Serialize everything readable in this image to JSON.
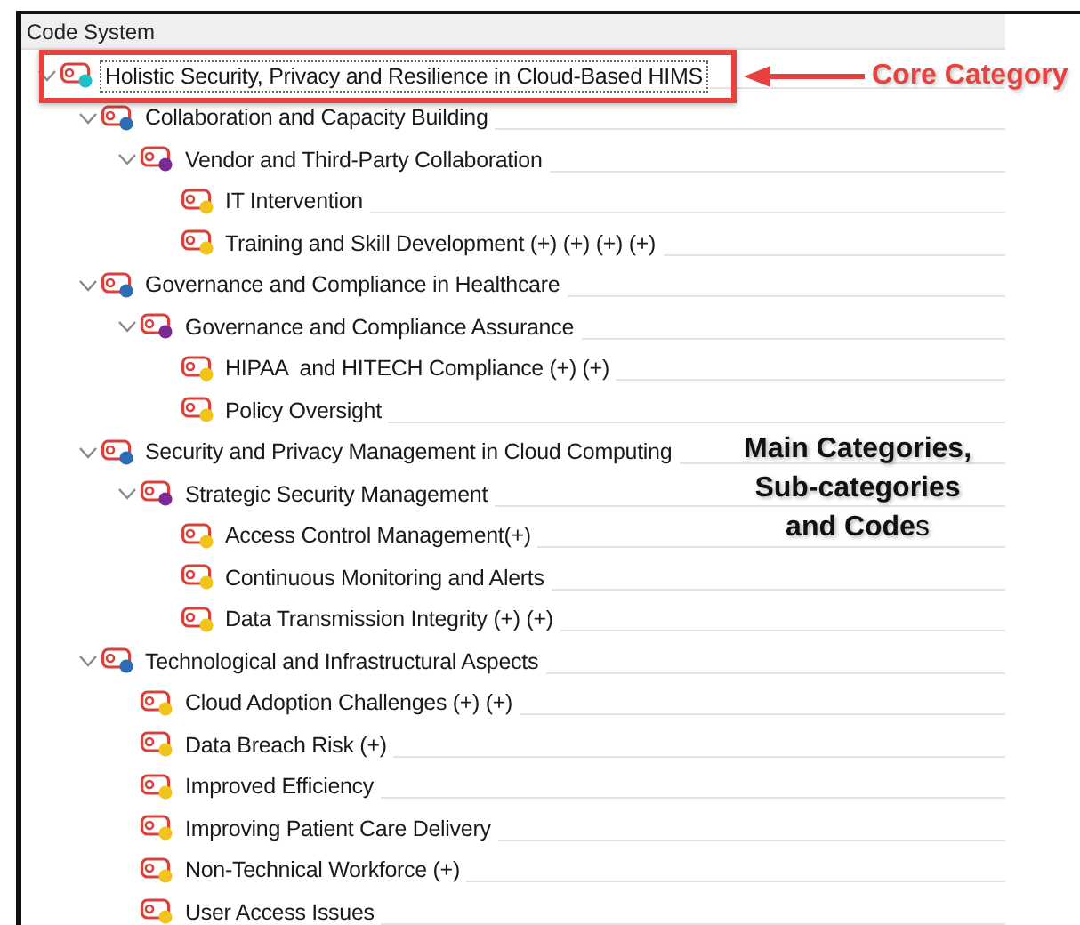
{
  "panel": {
    "title": "Code System"
  },
  "tree": [
    {
      "label": "Holistic Security, Privacy and Resilience in Cloud-Based HIMS",
      "color": "#1fc0c8",
      "expanded": true,
      "selected": true,
      "children": [
        {
          "label": "Collaboration and Capacity Building",
          "color": "#2a6db5",
          "expanded": true,
          "selected": false,
          "children": [
            {
              "label": "Vendor and Third-Party Collaboration",
              "color": "#7b2a95",
              "expanded": true,
              "selected": false,
              "children": [
                {
                  "label": "IT Intervention",
                  "color": "#f0c419",
                  "selected": false
                },
                {
                  "label": "Training and Skill Development (+) (+) (+) (+)",
                  "color": "#f0c419",
                  "selected": false
                }
              ]
            }
          ]
        },
        {
          "label": "Governance and Compliance in Healthcare",
          "color": "#2a6db5",
          "expanded": true,
          "selected": false,
          "children": [
            {
              "label": "Governance and Compliance Assurance",
              "color": "#7b2a95",
              "expanded": true,
              "selected": false,
              "children": [
                {
                  "label": "HIPAA  and HITECH Compliance (+) (+)",
                  "color": "#f0c419",
                  "selected": false
                },
                {
                  "label": "Policy Oversight",
                  "color": "#f0c419",
                  "selected": false
                }
              ]
            }
          ]
        },
        {
          "label": "Security and Privacy Management in Cloud Computing",
          "color": "#2a6db5",
          "expanded": true,
          "selected": false,
          "children": [
            {
              "label": "Strategic Security Management",
              "color": "#7b2a95",
              "expanded": true,
              "selected": false,
              "children": [
                {
                  "label": "Access Control Management(+)",
                  "color": "#f0c419",
                  "selected": false
                },
                {
                  "label": "Continuous Monitoring and Alerts",
                  "color": "#f0c419",
                  "selected": false
                },
                {
                  "label": "Data Transmission Integrity (+) (+)",
                  "color": "#f0c419",
                  "selected": false
                }
              ]
            }
          ]
        },
        {
          "label": "Technological and Infrastructural Aspects",
          "color": "#2a6db5",
          "expanded": true,
          "selected": false,
          "children": [
            {
              "label": "Cloud Adoption Challenges (+) (+)",
              "color": "#f0c419",
              "selected": false
            },
            {
              "label": "Data Breach Risk (+)",
              "color": "#f0c419",
              "selected": false
            },
            {
              "label": "Improved Efficiency",
              "color": "#f0c419",
              "selected": false
            },
            {
              "label": "Improving Patient Care Delivery",
              "color": "#f0c419",
              "selected": false
            },
            {
              "label": "Non-Technical Workforce (+)",
              "color": "#f0c419",
              "selected": false
            },
            {
              "label": "User Access Issues",
              "color": "#f0c419",
              "selected": false
            }
          ]
        }
      ]
    }
  ],
  "annotations": [
    {
      "kind": "callout",
      "text": "Core Category"
    },
    {
      "kind": "note",
      "text": "**Main Categories, Sub-categories and Code**s"
    }
  ]
}
